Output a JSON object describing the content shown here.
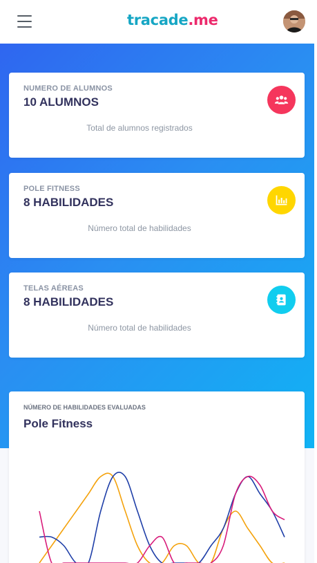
{
  "header": {
    "logo_part1": "tracade",
    "logo_part2": ".me",
    "menu_icon": "hamburger-icon",
    "avatar_icon": "user-avatar"
  },
  "stats": [
    {
      "kicker": "NUMERO DE ALUMNOS",
      "value": "10 ALUMNOS",
      "sub": "Total de alumnos registrados",
      "icon": "users-icon",
      "color": "#f5365c"
    },
    {
      "kicker": "POLE FITNESS",
      "value": "8 HABILIDADES",
      "sub": "Número total de habilidades",
      "icon": "chart-bar-icon",
      "color": "#ffd600"
    },
    {
      "kicker": "TELAS AÉREAS",
      "value": "8 HABILIDADES",
      "sub": "Número total de habilidades",
      "icon": "contact-book-icon",
      "color": "#11cdef"
    }
  ],
  "chart_card": {
    "kicker": "NÚMERO DE HABILIDADES EVALUADAS",
    "title": "Pole Fitness"
  },
  "chart_data": {
    "type": "line",
    "title": "Pole Fitness",
    "xlabel": "",
    "ylabel": "",
    "x": [
      0,
      1,
      2,
      3,
      4,
      5,
      6,
      7,
      8,
      9,
      10,
      11,
      12,
      13,
      14,
      15,
      16,
      17,
      18,
      19,
      20
    ],
    "ylim": [
      0,
      10
    ],
    "grid": false,
    "series": [
      {
        "color": "#f4a20c",
        "values": [
          0,
          2,
          4,
          6,
          8,
          10,
          10,
          6,
          2,
          0,
          0,
          2,
          2,
          0,
          0,
          4,
          6,
          4,
          2,
          0,
          0
        ]
      },
      {
        "color": "#1f3fa8",
        "values": [
          3,
          3,
          2,
          0,
          0,
          6,
          10,
          10,
          6,
          2,
          0,
          0,
          0,
          0,
          2,
          4,
          8,
          10,
          8,
          6,
          3
        ]
      },
      {
        "color": "#d81b7a",
        "values": [
          6,
          0,
          0,
          0,
          0,
          0,
          0,
          0,
          0,
          2,
          3,
          0,
          0,
          0,
          0,
          2,
          8,
          10,
          9,
          6,
          5
        ]
      }
    ]
  }
}
